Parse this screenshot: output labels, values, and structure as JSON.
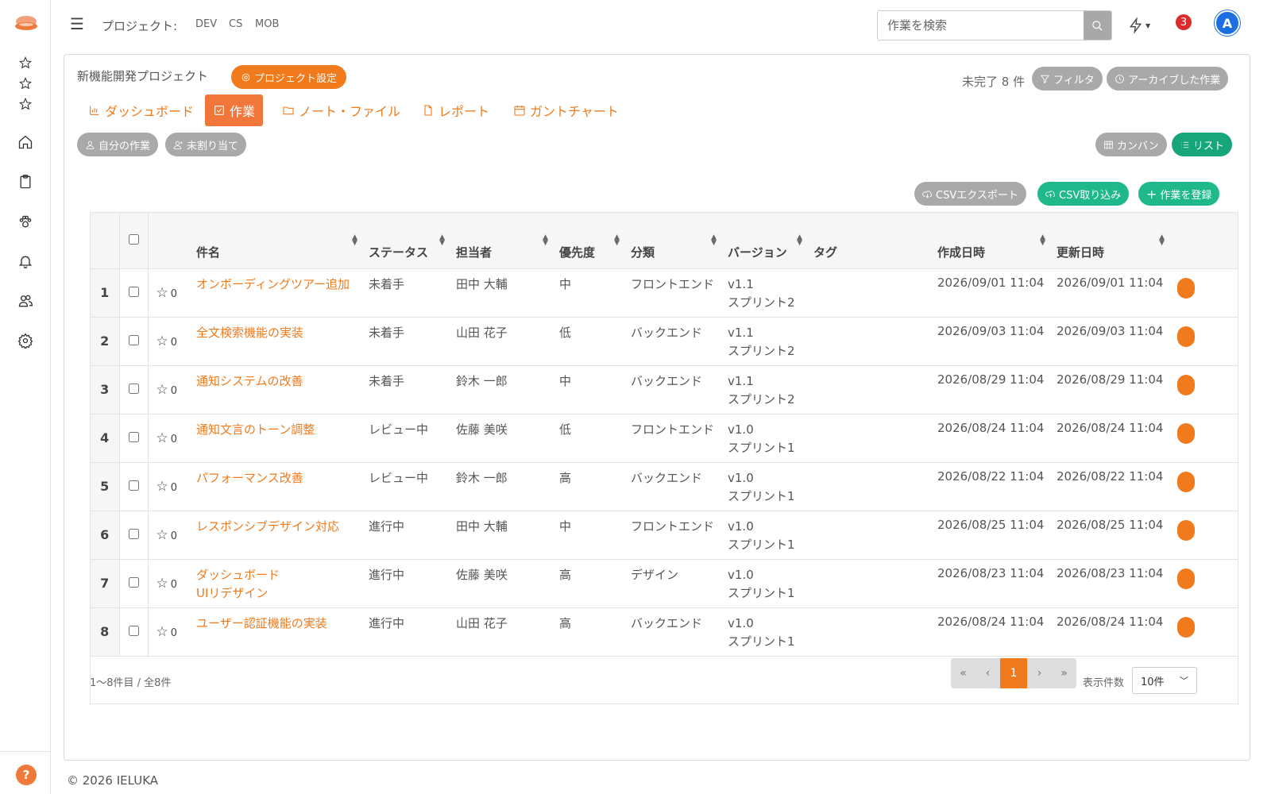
{
  "topbar": {
    "project_label": "プロジェクト:",
    "project_links": [
      "DEV",
      "CS",
      "MOB"
    ],
    "search_placeholder": "作業を検索",
    "notification_count": "3",
    "avatar_initial": "A"
  },
  "project": {
    "title": "新機能開発プロジェクト",
    "settings_label": "プロジェクト設定",
    "open_count": "未完了 8 件",
    "filter_label": "フィルタ",
    "archive_label": "アーカイブした作業"
  },
  "tabs": [
    {
      "label": "ダッシュボード",
      "icon": "bar-chart-icon"
    },
    {
      "label": "作業",
      "icon": "check-square-icon"
    },
    {
      "label": "ノート・ファイル",
      "icon": "folder-icon"
    },
    {
      "label": "レポート",
      "icon": "file-icon"
    },
    {
      "label": "ガントチャート",
      "icon": "calendar-icon"
    }
  ],
  "filters": {
    "my_tasks": "自分の作業",
    "unassigned": "未割り当て",
    "kanban": "カンバン",
    "list": "リスト"
  },
  "actions": {
    "csv_export": "CSVエクスポート",
    "csv_import": "CSV取り込み",
    "add_task": "作業を登録"
  },
  "table": {
    "headers": [
      "件名",
      "ステータス",
      "担当者",
      "優先度",
      "分類",
      "バージョン",
      "タグ",
      "作成日時",
      "更新日時"
    ],
    "rows": [
      {
        "num": "1",
        "stars": "0",
        "title": [
          "オンボーディングツアー追加"
        ],
        "status": "未着手",
        "assignee": "田中 大輔",
        "priority": "中",
        "category": "フロントエンド",
        "version": "v1.1",
        "sprint": "スプリント2",
        "tag": "",
        "created": "2026/09/01 11:04",
        "updated": "2026/09/01 11:04"
      },
      {
        "num": "2",
        "stars": "0",
        "title": [
          "全文検索機能の実装"
        ],
        "status": "未着手",
        "assignee": "山田 花子",
        "priority": "低",
        "category": "バックエンド",
        "version": "v1.1",
        "sprint": "スプリント2",
        "tag": "",
        "created": "2026/09/03 11:04",
        "updated": "2026/09/03 11:04"
      },
      {
        "num": "3",
        "stars": "0",
        "title": [
          "通知システムの改善"
        ],
        "status": "未着手",
        "assignee": "鈴木 一郎",
        "priority": "中",
        "category": "バックエンド",
        "version": "v1.1",
        "sprint": "スプリント2",
        "tag": "",
        "created": "2026/08/29 11:04",
        "updated": "2026/08/29 11:04"
      },
      {
        "num": "4",
        "stars": "0",
        "title": [
          "通知文言のトーン調整"
        ],
        "status": "レビュー中",
        "assignee": "佐藤 美咲",
        "priority": "低",
        "category": "フロントエンド",
        "version": "v1.0",
        "sprint": "スプリント1",
        "tag": "",
        "created": "2026/08/24 11:04",
        "updated": "2026/08/24 11:04"
      },
      {
        "num": "5",
        "stars": "0",
        "title": [
          "パフォーマンス改善"
        ],
        "status": "レビュー中",
        "assignee": "鈴木 一郎",
        "priority": "高",
        "category": "バックエンド",
        "version": "v1.0",
        "sprint": "スプリント1",
        "tag": "",
        "created": "2026/08/22 11:04",
        "updated": "2026/08/22 11:04"
      },
      {
        "num": "6",
        "stars": "0",
        "title": [
          "レスポンシブデザイン対応"
        ],
        "status": "進行中",
        "assignee": "田中 大輔",
        "priority": "中",
        "category": "フロントエンド",
        "version": "v1.0",
        "sprint": "スプリント1",
        "tag": "",
        "created": "2026/08/25 11:04",
        "updated": "2026/08/25 11:04"
      },
      {
        "num": "7",
        "stars": "0",
        "title": [
          "ダッシュボード",
          "UIリデザイン"
        ],
        "status": "進行中",
        "assignee": "佐藤 美咲",
        "priority": "高",
        "category": "デザイン",
        "version": "v1.0",
        "sprint": "スプリント1",
        "tag": "",
        "created": "2026/08/23 11:04",
        "updated": "2026/08/23 11:04"
      },
      {
        "num": "8",
        "stars": "0",
        "title": [
          "ユーザー認証機能の実装"
        ],
        "status": "進行中",
        "assignee": "山田 花子",
        "priority": "高",
        "category": "バックエンド",
        "version": "v1.0",
        "sprint": "スプリント1",
        "tag": "",
        "created": "2026/08/24 11:04",
        "updated": "2026/08/24 11:04"
      }
    ]
  },
  "pagination": {
    "info": "1〜8件目 / 全8件",
    "first": "«",
    "prev": "‹",
    "current": "1",
    "next": "›",
    "last": "»",
    "per_page_label": "表示件数",
    "per_page_value": "10件"
  },
  "footer": "© 2026 IELUKA",
  "colors": {
    "accent": "#f07a1c",
    "green": "#1fb88a",
    "gray_pill": "#a9a9a9",
    "badge_red": "#dc2b2b",
    "avatar_blue": "#1b6fe0"
  }
}
